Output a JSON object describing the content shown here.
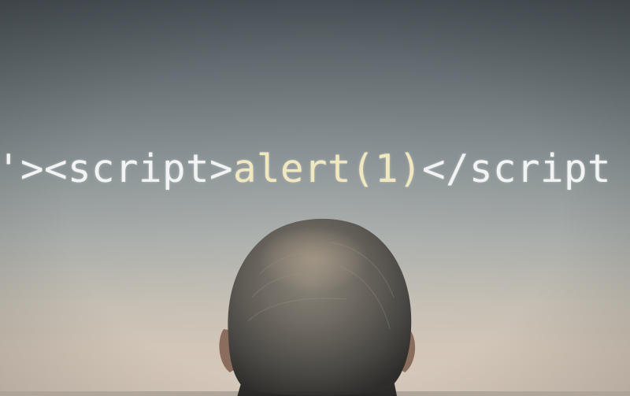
{
  "projected_code": {
    "part_open": "'><script>",
    "part_payload": "alert(1)",
    "part_close": "</script"
  },
  "colors": {
    "code_white": "#f2f4f4",
    "code_yellow": "#f1e9bd",
    "screen_top": "#4b5359",
    "screen_bottom": "#d6c9bb",
    "hair": "#6f6e6a"
  }
}
